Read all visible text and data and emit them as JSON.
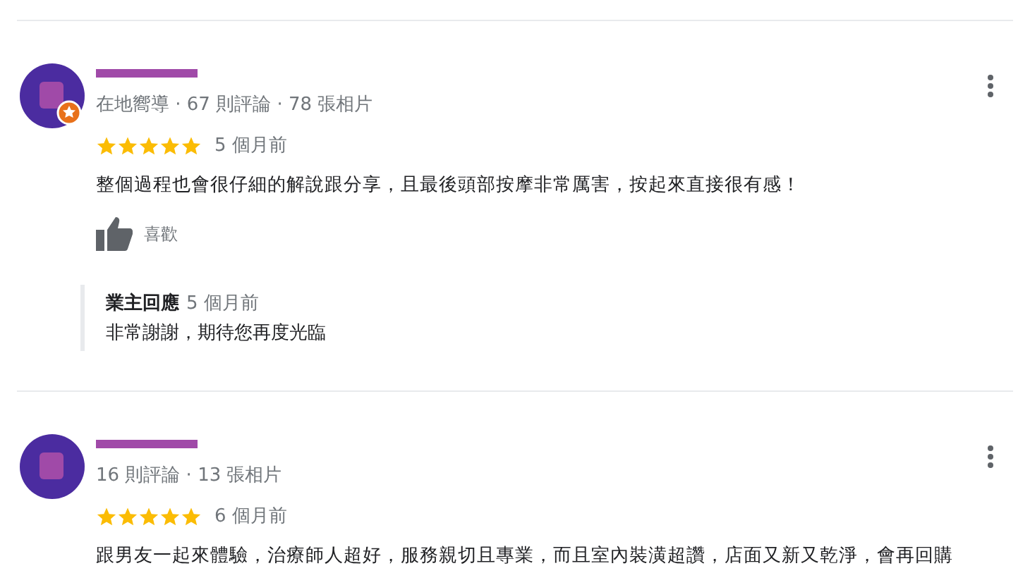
{
  "reviews": [
    {
      "local_guide": true,
      "meta": "在地嚮導 · 67 則評論 · 78 張相片",
      "stars": 5,
      "time": "5 個月前",
      "text": "整個過程也會很仔細的解說跟分享，且最後頭部按摩非常厲害，按起來直接很有感！",
      "like_label": "喜歡",
      "owner_reply": {
        "label": "業主回應",
        "time": "5 個月前",
        "text": "非常謝謝，期待您再度光臨"
      }
    },
    {
      "local_guide": false,
      "meta": "16 則評論 · 13 張相片",
      "stars": 5,
      "time": "6 個月前",
      "text": "跟男友一起來體驗，治療師人超好，服務親切且專業，而且室內裝潢超讚，店面又新又乾淨，會再回購"
    }
  ]
}
